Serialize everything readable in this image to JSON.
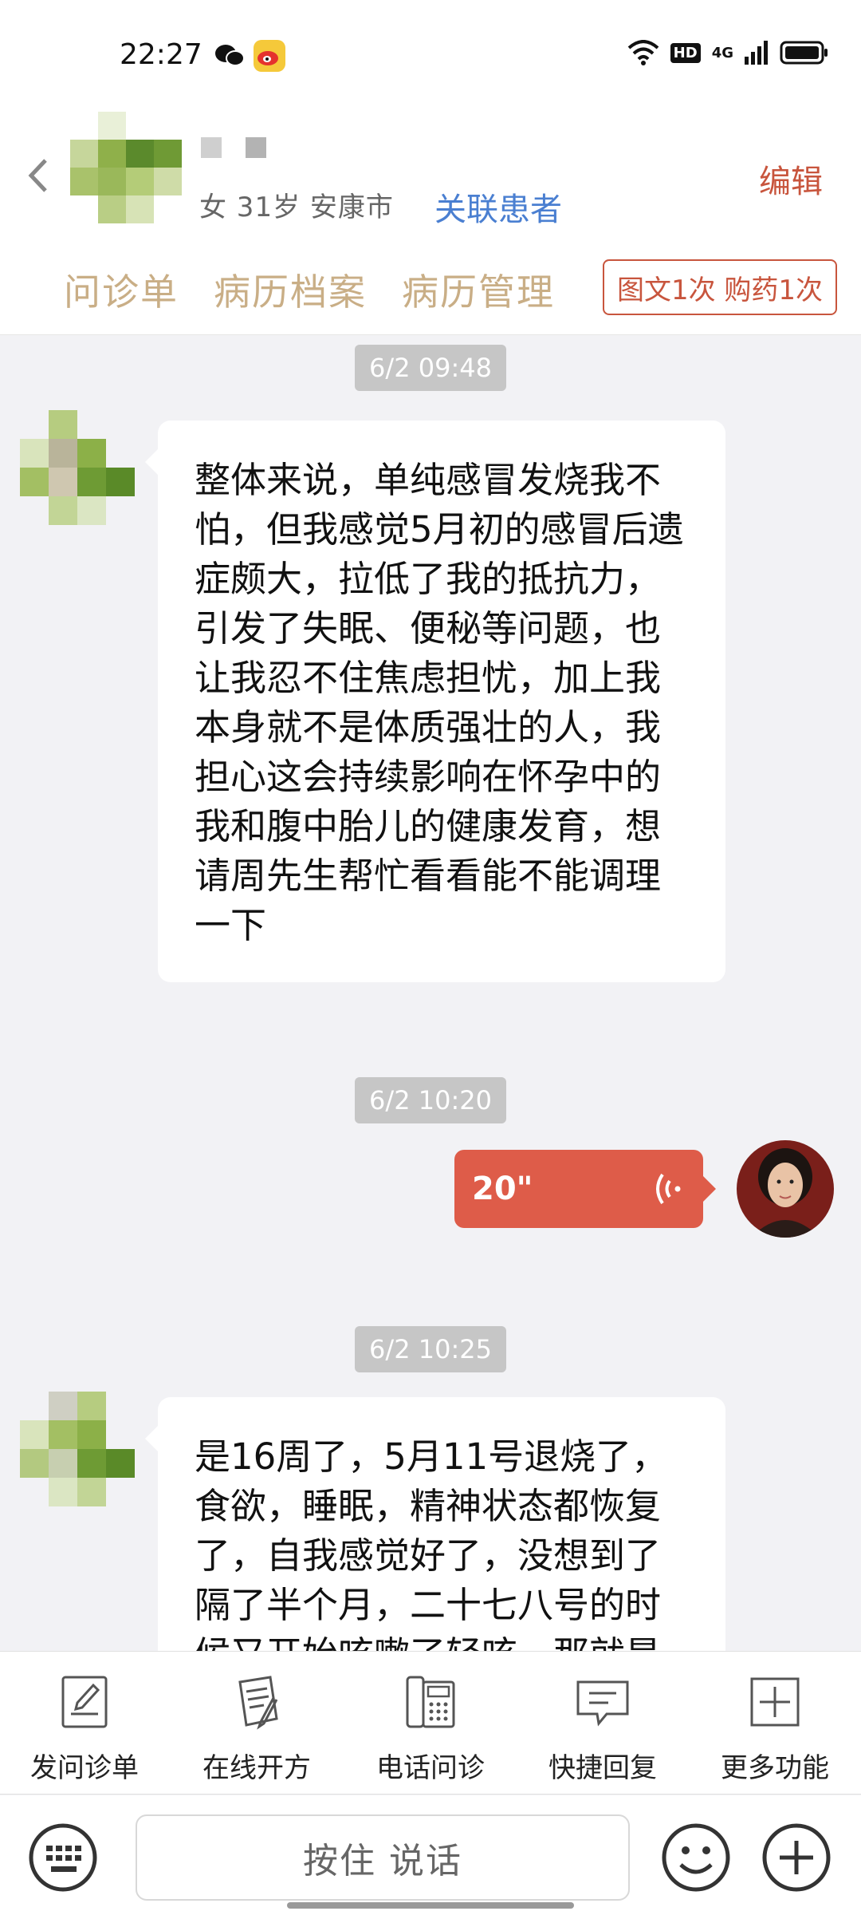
{
  "status_bar": {
    "time": "22:27",
    "hd_badge": "HD",
    "network": "4G",
    "icons": [
      "wechat-icon",
      "weibo-icon",
      "wifi-icon",
      "signal-icon",
      "battery-icon"
    ]
  },
  "header": {
    "patient_info": "女 31岁  安康市",
    "related_link": "关联患者",
    "edit_label": "编辑",
    "tabs": [
      "问诊单",
      "病历档案",
      "病历管理"
    ],
    "service_badge": "图文1次 购药1次"
  },
  "messages": [
    {
      "type": "timestamp",
      "text": "6/2 09:48"
    },
    {
      "type": "incoming_text",
      "text": "整体来说，单纯感冒发烧我不怕，但我感觉5月初的感冒后遗症颇大，拉低了我的抵抗力，引发了失眠、便秘等问题，也让我忍不住焦虑担忧，加上我本身就不是体质强壮的人，我担心这会持续影响在怀孕中的我和腹中胎儿的健康发育，想请周先生帮忙看看能不能调理一下"
    },
    {
      "type": "timestamp",
      "text": "6/2 10:20"
    },
    {
      "type": "outgoing_voice",
      "duration": "20\""
    },
    {
      "type": "timestamp",
      "text": "6/2 10:25"
    },
    {
      "type": "incoming_text",
      "text": "是16周了，5月11号退烧了，食欲，睡眠，精神状态都恢复了，自我感觉好了，没想到了隔了半个月，二十七八号的时候又开始咳嗽了轻咳，那就是"
    }
  ],
  "toolbar": [
    {
      "label": "发问诊单",
      "icon": "form-icon"
    },
    {
      "label": "在线开方",
      "icon": "prescription-icon"
    },
    {
      "label": "电话问诊",
      "icon": "phone-icon"
    },
    {
      "label": "快捷回复",
      "icon": "quick-reply-icon"
    },
    {
      "label": "更多功能",
      "icon": "more-icon"
    }
  ],
  "input_bar": {
    "talk_label": "按住 说话",
    "icons": [
      "keyboard-icon",
      "emoji-icon",
      "plus-icon"
    ]
  },
  "colors": {
    "accent": "#de5c49",
    "link": "#4a7fd1",
    "tab_text": "#c9ae86",
    "timestamp_bg": "#c6c6c6",
    "chat_bg": "#f2f2f5"
  }
}
